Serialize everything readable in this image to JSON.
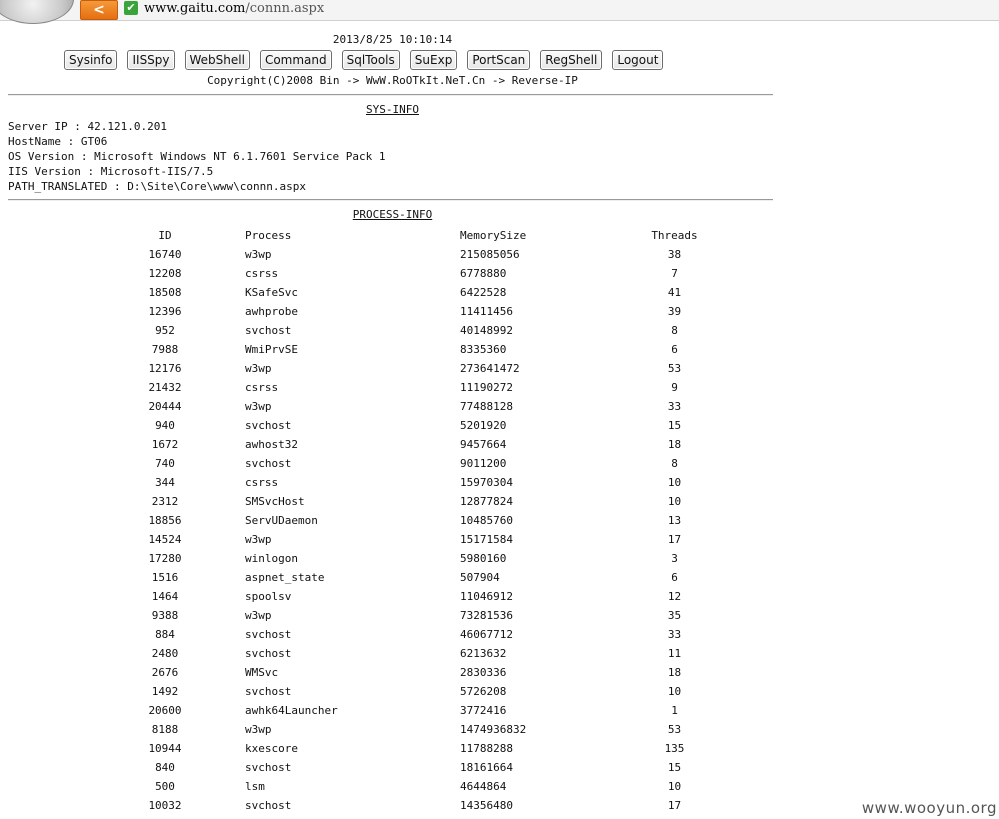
{
  "browser": {
    "back_label": "<",
    "secure_mark": "✔",
    "url_host": "www.gaitu.com",
    "url_path": "/connn.aspx"
  },
  "header": {
    "datetime": "2013/8/25 10:10:14",
    "copyright": "Copyright(C)2008 Bin -> WwW.RoOTkIt.NeT.Cn -> Reverse-IP"
  },
  "buttons": [
    "Sysinfo",
    "IISSpy",
    "WebShell",
    "Command",
    "SqlTools",
    "SuExp",
    "PortScan",
    "RegShell",
    "Logout"
  ],
  "sysinfo": {
    "title": "SYS-INFO",
    "lines": [
      "Server IP : 42.121.0.201",
      "HostName : GT06",
      "OS Version : Microsoft Windows NT 6.1.7601 Service Pack 1",
      "IIS Version : Microsoft-IIS/7.5",
      "PATH_TRANSLATED : D:\\Site\\Core\\www\\connn.aspx"
    ]
  },
  "processinfo": {
    "title": "PROCESS-INFO",
    "columns": [
      "ID",
      "Process",
      "MemorySize",
      "Threads"
    ],
    "rows": [
      [
        "16740",
        "w3wp",
        "215085056",
        "38"
      ],
      [
        "12208",
        "csrss",
        "6778880",
        "7"
      ],
      [
        "18508",
        "KSafeSvc",
        "6422528",
        "41"
      ],
      [
        "12396",
        "awhprobe",
        "11411456",
        "39"
      ],
      [
        "952",
        "svchost",
        "40148992",
        "8"
      ],
      [
        "7988",
        "WmiPrvSE",
        "8335360",
        "6"
      ],
      [
        "12176",
        "w3wp",
        "273641472",
        "53"
      ],
      [
        "21432",
        "csrss",
        "11190272",
        "9"
      ],
      [
        "20444",
        "w3wp",
        "77488128",
        "33"
      ],
      [
        "940",
        "svchost",
        "5201920",
        "15"
      ],
      [
        "1672",
        "awhost32",
        "9457664",
        "18"
      ],
      [
        "740",
        "svchost",
        "9011200",
        "8"
      ],
      [
        "344",
        "csrss",
        "15970304",
        "10"
      ],
      [
        "2312",
        "SMSvcHost",
        "12877824",
        "10"
      ],
      [
        "18856",
        "ServUDaemon",
        "10485760",
        "13"
      ],
      [
        "14524",
        "w3wp",
        "15171584",
        "17"
      ],
      [
        "17280",
        "winlogon",
        "5980160",
        "3"
      ],
      [
        "1516",
        "aspnet_state",
        "507904",
        "6"
      ],
      [
        "1464",
        "spoolsv",
        "11046912",
        "12"
      ],
      [
        "9388",
        "w3wp",
        "73281536",
        "35"
      ],
      [
        "884",
        "svchost",
        "46067712",
        "33"
      ],
      [
        "2480",
        "svchost",
        "6213632",
        "11"
      ],
      [
        "2676",
        "WMSvc",
        "2830336",
        "18"
      ],
      [
        "1492",
        "svchost",
        "5726208",
        "10"
      ],
      [
        "20600",
        "awhk64Launcher",
        "3772416",
        "1"
      ],
      [
        "8188",
        "w3wp",
        "1474936832",
        "53"
      ],
      [
        "10944",
        "kxescore",
        "11788288",
        "135"
      ],
      [
        "840",
        "svchost",
        "18161664",
        "15"
      ],
      [
        "500",
        "lsm",
        "4644864",
        "10"
      ],
      [
        "10032",
        "svchost",
        "14356480",
        "17"
      ]
    ]
  },
  "watermark": "www.wooyun.org"
}
